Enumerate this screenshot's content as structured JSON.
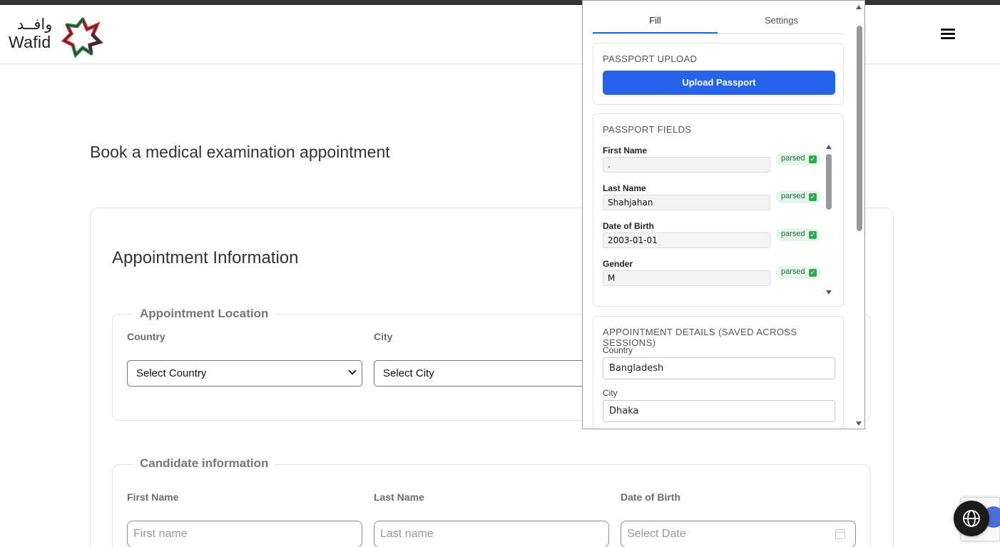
{
  "header": {
    "logo_arabic": "وافــد",
    "logo_english": "Wafid",
    "menu_icon": "hamburger-icon"
  },
  "page": {
    "title": "Book a medical examination appointment"
  },
  "form": {
    "card_title": "Appointment Information",
    "location": {
      "legend": "Appointment Location",
      "country_label": "Country",
      "country_value": "Select Country",
      "city_label": "City",
      "city_value": "Select City"
    },
    "candidate": {
      "legend": "Candidate information",
      "first_name_label": "First Name",
      "first_name_placeholder": "First name",
      "last_name_label": "Last Name",
      "last_name_placeholder": "Last name",
      "dob_label": "Date of Birth",
      "dob_placeholder": "Select Date"
    }
  },
  "floating": {
    "globe_icon": "globe-icon"
  },
  "extension": {
    "tabs": [
      {
        "label": "Fill",
        "active": true
      },
      {
        "label": "Settings",
        "active": false
      }
    ],
    "passport_upload": {
      "title": "PASSPORT UPLOAD",
      "button_label": "Upload Passport"
    },
    "passport_fields": {
      "title": "PASSPORT FIELDS",
      "fields": [
        {
          "label": "First Name",
          "value": ".",
          "status": "parsed"
        },
        {
          "label": "Last Name",
          "value": "Shahjahan",
          "status": "parsed"
        },
        {
          "label": "Date of Birth",
          "value": "2003-01-01",
          "status": "parsed"
        },
        {
          "label": "Gender",
          "value": "M",
          "status": "parsed"
        }
      ]
    },
    "appointment_details": {
      "title": "APPOINTMENT DETAILS (SAVED ACROSS SESSIONS)",
      "country_label": "Country",
      "country_value": "Bangladesh",
      "city_label": "City",
      "city_value": "Dhaka"
    }
  },
  "colors": {
    "primary": "#2563eb",
    "parsed_bg": "#e6f6ea",
    "parsed_check": "#2eaa52",
    "logo_green": "#2e8b3d",
    "logo_red": "#d2232a",
    "logo_dark": "#3b2a33"
  }
}
